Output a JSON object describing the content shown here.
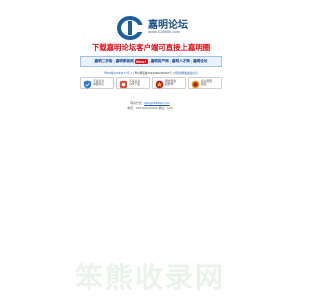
{
  "logo": {
    "title": "嘉明论坛",
    "url": "www.528600.com"
  },
  "banner": {
    "text": "下载嘉明论坛客户端可直接上嘉明圈"
  },
  "nav": {
    "links": [
      "嘉明二手街",
      "嘉明家装网",
      "嘉明房产网",
      "嘉明人才网",
      "嘉明论坛"
    ],
    "new_badge": "New!"
  },
  "info": {
    "prefix": "粤ICP备12043177号-1",
    "middle": " | 粤公网安备44190002000XX号 | ",
    "suffix": "经营性网站备案信息"
  },
  "badges": [
    {
      "line1": "不良信息",
      "line2": "举报中心",
      "icon": "shield-icon",
      "color": "#2a7ad5"
    },
    {
      "line1": "不良信息",
      "line2": "APP下载",
      "icon": "app-icon",
      "color": "#e0463a"
    },
    {
      "line1": "网络警察",
      "line2": "提醒你",
      "icon": "police-icon",
      "color": "#c8102e"
    },
    {
      "line1": "嘉兴网安",
      "line2": "备案",
      "icon": "badge-icon",
      "color": "#d4a017"
    }
  ],
  "contact": {
    "label": "联系方式：",
    "email": "bbs@528600.com"
  },
  "license": "电话：XXX-XXXXXXXX 地址：XXX"
}
